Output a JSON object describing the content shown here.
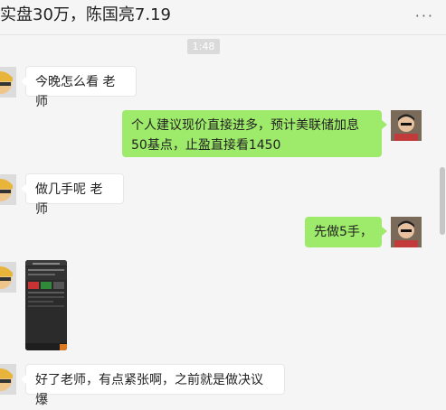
{
  "header": {
    "title": "实盘30万，陈国亮7.19",
    "more_glyph": "···"
  },
  "timestamp": "1:48",
  "messages": [
    {
      "side": "in",
      "text": "今晚怎么看 老师"
    },
    {
      "side": "out",
      "text": "个人建议现价直接进多，预计美联储加息50基点，止盈直接看1450"
    },
    {
      "side": "in",
      "text": "做几手呢 老师"
    },
    {
      "side": "out",
      "text": "先做5手，"
    },
    {
      "side": "in",
      "type": "image",
      "text": ""
    },
    {
      "side": "in",
      "text": "好了老师，有点紧张啊，之前就是做决议爆"
    }
  ],
  "colors": {
    "background": "#f5f5f5",
    "incoming_bubble": "#ffffff",
    "outgoing_bubble": "#9eea6a"
  }
}
